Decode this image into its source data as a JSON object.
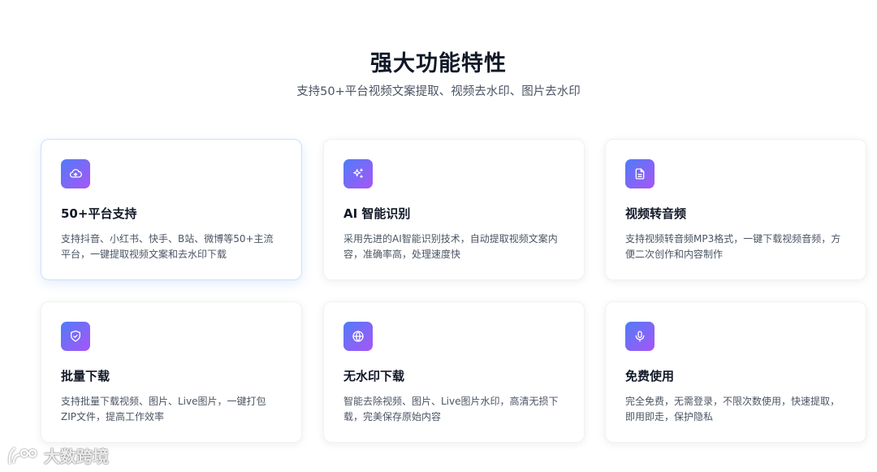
{
  "header": {
    "title": "强大功能特性",
    "subtitle": "支持50+平台视频文案提取、视频去水印、图片去水印"
  },
  "features": [
    {
      "icon": "cloud-upload-icon",
      "title": "50+平台支持",
      "desc_lines": [
        "支持抖音、小红书、快手、B站、微博等50+主流",
        "平台，一键提取视频文案和去水印下载"
      ]
    },
    {
      "icon": "sparkles-icon",
      "title": "AI 智能识别",
      "desc_lines": [
        "采用先进的AI智能识别技术，自动提取视频文案内",
        "容，准确率高，处理速度快"
      ]
    },
    {
      "icon": "document-icon",
      "title": "视频转音频",
      "desc_lines": [
        "支持视频转音频MP3格式，一键下载视频音频，方",
        "便二次创作和内容制作"
      ]
    },
    {
      "icon": "shield-check-icon",
      "title": "批量下载",
      "desc_lines": [
        "支持批量下载视频、图片、Live图片，一键打包",
        "ZIP文件，提高工作效率"
      ]
    },
    {
      "icon": "globe-icon",
      "title": "无水印下载",
      "desc_lines": [
        "智能去除视频、图片、Live图片水印，高清无损下",
        "载，完美保存原始内容"
      ]
    },
    {
      "icon": "microphone-icon",
      "title": "免费使用",
      "desc_lines": [
        "完全免费，无需登录，不限次数使用，快速提取，",
        "即用即走，保护隐私"
      ]
    }
  ],
  "watermark": {
    "text": "大数跨境"
  },
  "colors": {
    "icon_gradient_start": "#4f7cf7",
    "icon_gradient_end": "#a855f7",
    "active_border": "#cfe0f5"
  }
}
